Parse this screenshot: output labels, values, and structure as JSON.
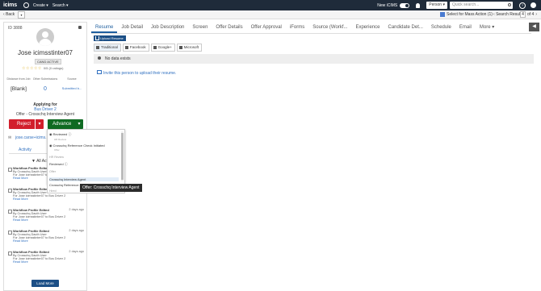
{
  "topbar": {
    "logo": "icims",
    "menus": [
      "Create",
      "Search"
    ],
    "new_icims_label": "New iCIMS",
    "person_select": "Person",
    "quick_search_placeholder": "Quick search..."
  },
  "subbar": {
    "back_label": "Back",
    "mass_action_label": "Select for Mass Action (1)",
    "search_results_label": "Search Result",
    "page_current": "4",
    "page_total_label": "of 4"
  },
  "profile": {
    "id_label": "ID 3888",
    "name": "Jose icimsstinter07",
    "status": "CAND ACTIVE",
    "stars": "☆☆☆☆☆",
    "rating_text": "0/5 (0 ratings)",
    "meta": [
      {
        "label": "Distance from Job",
        "value": "[Blank]"
      },
      {
        "label": "Other Submissions",
        "value": "0"
      },
      {
        "label": "Source",
        "value": "Submitted b..."
      }
    ],
    "applying_for_label": "Applying for",
    "job": "Bus Driver 2",
    "offer": "Offer - Crosschq Interview Agent",
    "reject_label": "Reject",
    "advance_label": "Advance",
    "email": "jose.carse+icims...",
    "activity_tab": "Activity",
    "all_activity_label": "All Acti...",
    "feed": [
      {
        "title": "Workflow Profile Edited",
        "date": "",
        "by": "By Crosschq Dauth User",
        "desc": "For Jose icimsstinter07 to Bus Driver 2",
        "more": "Read More"
      },
      {
        "title": "Workflow Profile Edited",
        "date": "",
        "by": "By Crosschq Dauth User",
        "desc": "For Jose icimsstinter07 to Bus Driver 2",
        "more": "Read More"
      },
      {
        "title": "Workflow Profile Edited",
        "date": "2 days ago",
        "by": "By Crosschq Dauth User",
        "desc": "For Jose icimsstinter07 to Bus Driver 2",
        "more": "Read More"
      },
      {
        "title": "Workflow Profile Edited",
        "date": "2 days ago",
        "by": "By Crosschq Dauth User",
        "desc": "For Jose icimsstinter07 to Bus Driver 2",
        "more": "Read More"
      },
      {
        "title": "Workflow Profile Edited",
        "date": "2 days ago",
        "by": "By Crosschq Dauth User",
        "desc": "For Jose icimsstinter07 to Bus Driver 2",
        "more": "Read More"
      }
    ],
    "load_more_label": "Load More"
  },
  "tabs": [
    "Resume",
    "Job Detail",
    "Job Description",
    "Screen",
    "Offer Details",
    "Offer Approval",
    "iForms",
    "Source (Workf...",
    "Experience",
    "Candidate Det...",
    "Schedule",
    "Email",
    "More"
  ],
  "resume": {
    "upload_label": "Upload Resume",
    "import_tabs": [
      "Traditional",
      "Facebook",
      "Google+",
      "Microsoft"
    ],
    "no_data": "No data exists",
    "invite_link": "Invite this person to upload their resume."
  },
  "advance_menu": {
    "items": [
      {
        "label": "Reviewed",
        "sub": "HR Review"
      },
      {
        "label": "Crosschq Reference Check Initiated",
        "sub": "Offer"
      },
      {
        "section": "HR Review"
      },
      {
        "label": "Reviewed",
        "sub": ""
      },
      {
        "section": "Offer"
      },
      {
        "label": "Crosschq Interview Agent",
        "sub": ""
      },
      {
        "label": "Crosschq Reference...",
        "sub": ""
      },
      {
        "section": "Hired"
      }
    ],
    "tooltip": "Offer: Crosschq Interview Agent"
  }
}
